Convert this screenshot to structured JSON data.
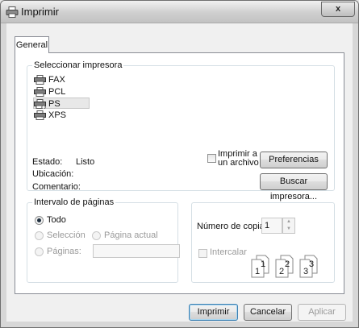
{
  "window": {
    "title": "Imprimir",
    "close": "x"
  },
  "tabs": [
    {
      "label": "General"
    }
  ],
  "printer_group": {
    "legend": "Seleccionar impresora",
    "printers": [
      "FAX",
      "PCL",
      "PS",
      "XPS"
    ],
    "selected": "PS",
    "status_label": "Estado:",
    "status_value": "Listo",
    "location_label": "Ubicación:",
    "comment_label": "Comentario:",
    "print_to_file_line1": "Imprimir a",
    "print_to_file_line2": "un archivo",
    "preferences_label": "Preferencias",
    "find_printer_label": "Buscar impresora..."
  },
  "page_range": {
    "legend": "Intervalo de páginas",
    "all_label": "Todo",
    "selection_label": "Selección",
    "current_page_label": "Página actual",
    "pages_label": "Páginas:",
    "pages_value": ""
  },
  "copies": {
    "label": "Número de copias:",
    "value": "1",
    "collate_label": "Intercalar",
    "collate_pages": [
      "1",
      "1",
      "2",
      "2",
      "3",
      "3"
    ]
  },
  "footer": {
    "print_label": "Imprimir",
    "cancel_label": "Cancelar",
    "apply_label": "Aplicar"
  },
  "colors": {
    "accent_border": "#3c7fb1",
    "disabled_text": "#9a9a9a"
  }
}
